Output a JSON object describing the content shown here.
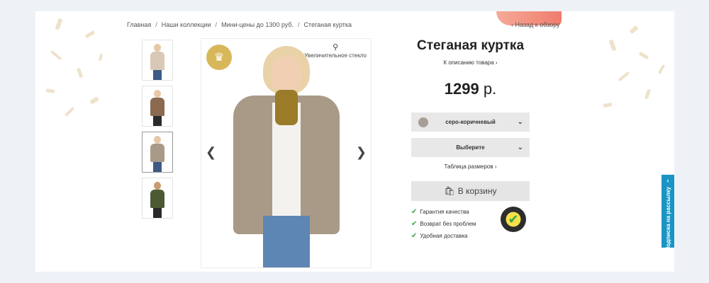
{
  "breadcrumb": {
    "items": [
      "Главная",
      "Наши коллекции",
      "Мини-цены до 1300 руб.",
      "Стеганая куртка"
    ],
    "separator": "/"
  },
  "back_link": "‹ Назад к обзору",
  "gallery": {
    "zoom_label": "Увеличительное стекло",
    "thumbnail_colors": [
      "#d9c8b6",
      "#8b6a50",
      "#a99a88",
      "#4c5a32"
    ]
  },
  "product": {
    "title": "Стеганая куртка",
    "description_link": "К описанию товара ›",
    "price_value": "1299",
    "price_currency": "р.",
    "color_select": "серо-коричневый",
    "size_select": "Выберите",
    "size_table_link": "Таблица размеров ›",
    "cart_button": "В корзину",
    "benefits": [
      "Гарантия качества",
      "Возврат без проблем",
      "Удобная доставка"
    ]
  },
  "subscribe_tab": "Подписка на рассылку",
  "colors": {
    "accent": "#1a95c3",
    "crown_badge": "#d8b75a",
    "check": "#3aa54a"
  }
}
